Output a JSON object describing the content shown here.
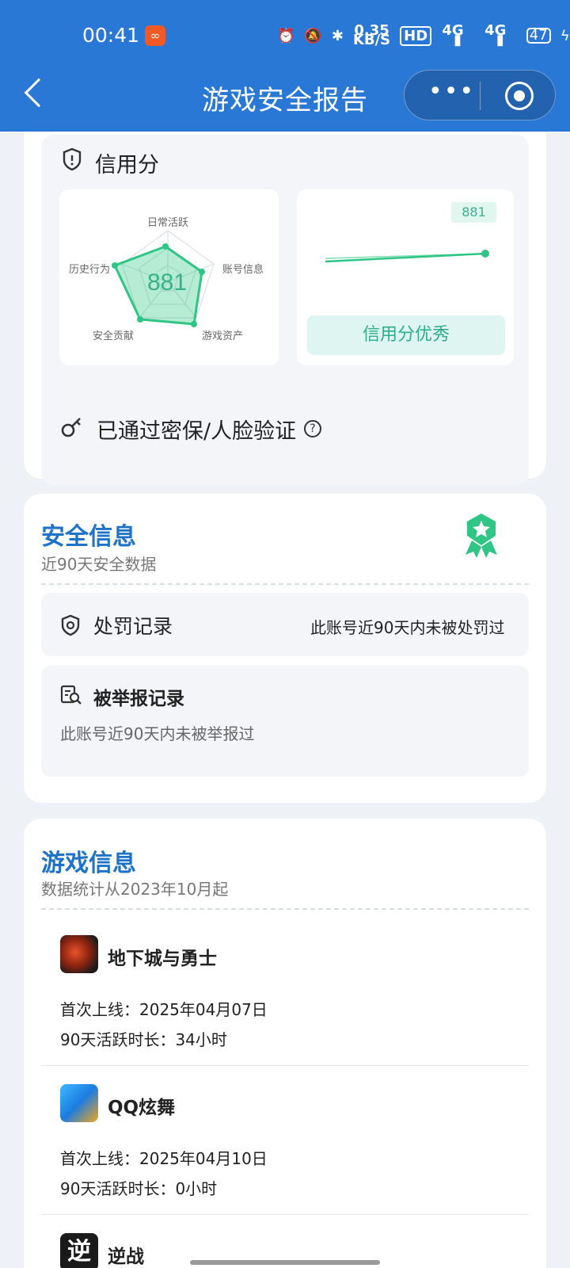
{
  "status_bar": {
    "time": "00:41",
    "app_badge_icon": "app-badge-icon",
    "speed_value": "0.35",
    "speed_unit": "KB/S",
    "hd": "HD",
    "net1": "4G",
    "net2": "4G",
    "battery": "47"
  },
  "header": {
    "title": "游戏安全报告",
    "menu_dots": "•••",
    "background_color": "#2a78d6"
  },
  "credit": {
    "section_title": "信用分",
    "score": "881",
    "radar_axes": [
      "日常活跃",
      "账号信息",
      "游戏资产",
      "安全贡献",
      "历史行为"
    ],
    "trend_badge": "881",
    "rating_label": "信用分优秀",
    "accent_color": "#2fc584"
  },
  "verification": {
    "label": "已通过密保/人脸验证",
    "help_symbol": "?"
  },
  "safety": {
    "title": "安全信息",
    "subtitle": "近90天安全数据",
    "punishment_label": "处罚记录",
    "punishment_value": "此账号近90天内未被处罚过",
    "report_label": "被举报记录",
    "report_value": "此账号近90天内未被举报过"
  },
  "games": {
    "title": "游戏信息",
    "subtitle": "数据统计从2023年10月起",
    "items": [
      {
        "name": "地下城与勇士",
        "first_online": "首次上线：2025年04月07日",
        "active": "90天活跃时长：34小时"
      },
      {
        "name": "QQ炫舞",
        "first_online": "首次上线：2025年04月10日",
        "active": "90天活跃时长：0小时"
      },
      {
        "name": "逆战"
      }
    ]
  }
}
